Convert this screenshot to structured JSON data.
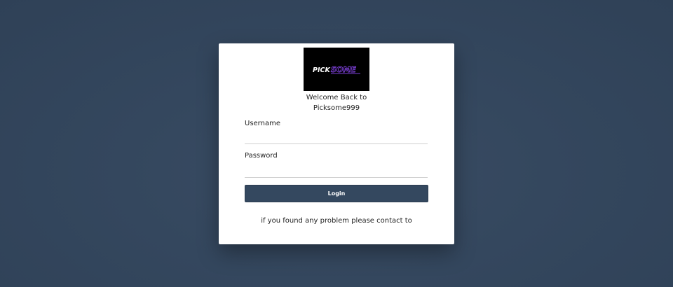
{
  "logo": {
    "text_part1": "PICK",
    "text_part2": "SOME",
    "colors": {
      "background": "#000000",
      "white": "#ffffff",
      "purple": "#7b3fd6"
    }
  },
  "welcome": {
    "line1": "Welcome Back to",
    "line2": "Picksome999"
  },
  "form": {
    "username_label": "Username",
    "username_value": "",
    "password_label": "Password",
    "password_value": "",
    "login_label": "Login"
  },
  "footer": {
    "contact_text": "if you found any problem please contact to"
  },
  "colors": {
    "page_background": "#34475e",
    "card_background": "#ffffff",
    "button_background": "#34485f",
    "button_text": "#ffffff"
  }
}
